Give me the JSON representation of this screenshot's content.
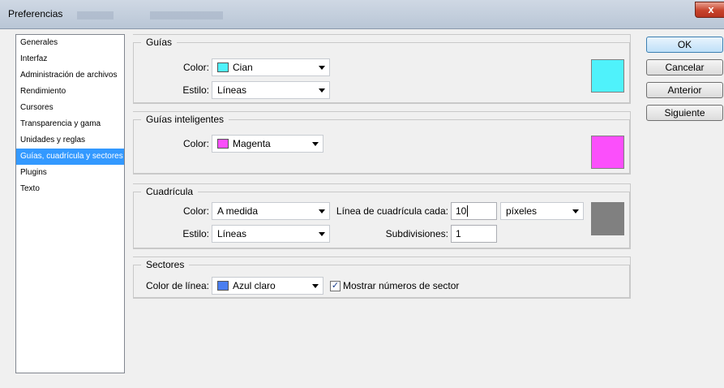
{
  "window": {
    "title": "Preferencias",
    "close_label": "x"
  },
  "sidebar": {
    "items": [
      {
        "label": "Generales"
      },
      {
        "label": "Interfaz"
      },
      {
        "label": "Administración de archivos"
      },
      {
        "label": "Rendimiento"
      },
      {
        "label": "Cursores"
      },
      {
        "label": "Transparencia y gama"
      },
      {
        "label": "Unidades y reglas"
      },
      {
        "label": "Guías, cuadrícula y sectores",
        "selected": true
      },
      {
        "label": "Plugins"
      },
      {
        "label": "Texto"
      }
    ]
  },
  "guias": {
    "legend": "Guías",
    "color_label": "Color:",
    "color_value": "Cian",
    "color_hex": "#4ff2fb",
    "style_label": "Estilo:",
    "style_value": "Líneas"
  },
  "guias_inteligentes": {
    "legend": "Guías inteligentes",
    "color_label": "Color:",
    "color_value": "Magenta",
    "color_hex": "#fb4ffb"
  },
  "cuadricula": {
    "legend": "Cuadrícula",
    "color_label": "Color:",
    "color_value": "A medida",
    "color_hex": "#808080",
    "style_label": "Estilo:",
    "style_value": "Líneas",
    "gridline_label": "Línea de cuadrícula cada:",
    "gridline_value": "10",
    "gridline_unit": "píxeles",
    "subdivisions_label": "Subdivisiones:",
    "subdivisions_value": "1"
  },
  "sectores": {
    "legend": "Sectores",
    "line_color_label": "Color de línea:",
    "line_color_value": "Azul claro",
    "line_color_hex": "#4a7ef0",
    "show_numbers_label": "Mostrar números de sector",
    "show_numbers_checked": true
  },
  "buttons": {
    "ok": "OK",
    "cancel": "Cancelar",
    "previous": "Anterior",
    "next": "Siguiente"
  }
}
